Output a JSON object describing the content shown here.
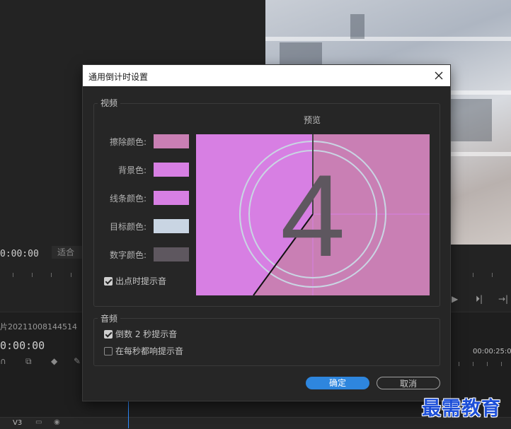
{
  "background": {
    "monitor_timecode": "0:00:00",
    "fit_label": "适合",
    "sequence_name": "片20211008144514",
    "timeline_timecode": "0:00:00",
    "ruler_timecode": "00:00:25:0",
    "track_label": "V3"
  },
  "dialog": {
    "title": "通用倒计时设置",
    "video_group": {
      "label": "视频",
      "preview_label": "预览",
      "rows": [
        {
          "label": "擦除颜色:",
          "color": "#c97fb4"
        },
        {
          "label": "背景色:",
          "color": "#d77fe3"
        },
        {
          "label": "线条颜色:",
          "color": "#d77fe3"
        },
        {
          "label": "目标颜色:",
          "color": "#c9d5e3"
        },
        {
          "label": "数字颜色:",
          "color": "#5e575f"
        }
      ],
      "cue_at_out": {
        "label": "出点时提示音",
        "checked": true
      },
      "preview_digit": "4"
    },
    "audio_group": {
      "label": "音频",
      "two_second_beep": {
        "label": "倒数 2 秒提示音",
        "checked": true
      },
      "every_second_beep": {
        "label": "在每秒都响提示音",
        "checked": false
      }
    },
    "ok_label": "确定",
    "cancel_label": "取消"
  },
  "watermark": "最需教育"
}
